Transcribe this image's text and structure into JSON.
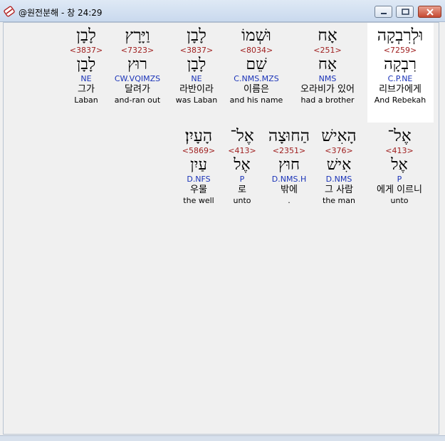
{
  "window": {
    "title": "@원전분해 - 창 24:29"
  },
  "words": [
    {
      "heb": "וּלְרִבְקָה",
      "strong": "<7259>",
      "lemma": "רִבְקָה",
      "morph": "C.P.NE",
      "kor": "리브가에게",
      "eng": "And Rebekah"
    },
    {
      "heb": "אָח",
      "strong": "<251>",
      "lemma": "אָח",
      "morph": "NMS",
      "kor": "오라비가 있어",
      "eng": "had a brother"
    },
    {
      "heb": "וּשְׁמוֹ",
      "strong": "<8034>",
      "lemma": "שֵׁם",
      "morph": "C.NMS.MZS",
      "kor": "이름은",
      "eng": "and his name"
    },
    {
      "heb": "לָבָן",
      "strong": "<3837>",
      "lemma": "לָבָן",
      "morph": "NE",
      "kor": "라반이라",
      "eng": "was Laban"
    },
    {
      "heb": "וַיָּרָץ",
      "strong": "<7323>",
      "lemma": "רוּץ",
      "morph": "CW.VQIMZS",
      "kor": "달려가",
      "eng": "and-ran out"
    },
    {
      "heb": "לָבָן",
      "strong": "<3837>",
      "lemma": "לָבָן",
      "morph": "NE",
      "kor": "그가",
      "eng": "Laban"
    },
    {
      "heb": "אֶל־",
      "strong": "<413>",
      "lemma": "אֶל",
      "morph": "P",
      "kor": "에게 이르니",
      "eng": "unto"
    },
    {
      "heb": "הָאִישׁ",
      "strong": "<376>",
      "lemma": "אִישׁ",
      "morph": "D.NMS",
      "kor": "그 사람",
      "eng": "the man"
    },
    {
      "heb": "הַחוּצָה",
      "strong": "<2351>",
      "lemma": "חוּץ",
      "morph": "D.NMS.H",
      "kor": "밖에",
      "eng": "."
    },
    {
      "heb": "אֶל־",
      "strong": "<413>",
      "lemma": "אֶל",
      "morph": "P",
      "kor": "로",
      "eng": "unto"
    },
    {
      "heb": "הָעָיִן׃",
      "strong": "<5869>",
      "lemma": "עַיִן",
      "morph": "D.NFS",
      "kor": "우물",
      "eng": "the well"
    }
  ]
}
